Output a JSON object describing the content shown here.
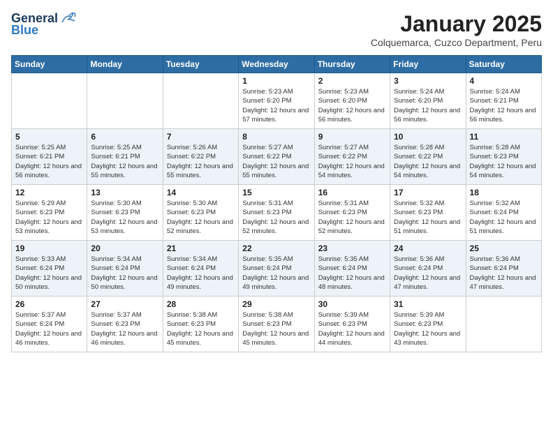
{
  "logo": {
    "general": "General",
    "blue": "Blue"
  },
  "title": "January 2025",
  "subtitle": "Colquemarca, Cuzco Department, Peru",
  "weekdays": [
    "Sunday",
    "Monday",
    "Tuesday",
    "Wednesday",
    "Thursday",
    "Friday",
    "Saturday"
  ],
  "weeks": [
    [
      {
        "day": "",
        "sunrise": "",
        "sunset": "",
        "daylight": ""
      },
      {
        "day": "",
        "sunrise": "",
        "sunset": "",
        "daylight": ""
      },
      {
        "day": "",
        "sunrise": "",
        "sunset": "",
        "daylight": ""
      },
      {
        "day": "1",
        "sunrise": "Sunrise: 5:23 AM",
        "sunset": "Sunset: 6:20 PM",
        "daylight": "Daylight: 12 hours and 57 minutes."
      },
      {
        "day": "2",
        "sunrise": "Sunrise: 5:23 AM",
        "sunset": "Sunset: 6:20 PM",
        "daylight": "Daylight: 12 hours and 56 minutes."
      },
      {
        "day": "3",
        "sunrise": "Sunrise: 5:24 AM",
        "sunset": "Sunset: 6:20 PM",
        "daylight": "Daylight: 12 hours and 56 minutes."
      },
      {
        "day": "4",
        "sunrise": "Sunrise: 5:24 AM",
        "sunset": "Sunset: 6:21 PM",
        "daylight": "Daylight: 12 hours and 56 minutes."
      }
    ],
    [
      {
        "day": "5",
        "sunrise": "Sunrise: 5:25 AM",
        "sunset": "Sunset: 6:21 PM",
        "daylight": "Daylight: 12 hours and 56 minutes."
      },
      {
        "day": "6",
        "sunrise": "Sunrise: 5:25 AM",
        "sunset": "Sunset: 6:21 PM",
        "daylight": "Daylight: 12 hours and 55 minutes."
      },
      {
        "day": "7",
        "sunrise": "Sunrise: 5:26 AM",
        "sunset": "Sunset: 6:22 PM",
        "daylight": "Daylight: 12 hours and 55 minutes."
      },
      {
        "day": "8",
        "sunrise": "Sunrise: 5:27 AM",
        "sunset": "Sunset: 6:22 PM",
        "daylight": "Daylight: 12 hours and 55 minutes."
      },
      {
        "day": "9",
        "sunrise": "Sunrise: 5:27 AM",
        "sunset": "Sunset: 6:22 PM",
        "daylight": "Daylight: 12 hours and 54 minutes."
      },
      {
        "day": "10",
        "sunrise": "Sunrise: 5:28 AM",
        "sunset": "Sunset: 6:22 PM",
        "daylight": "Daylight: 12 hours and 54 minutes."
      },
      {
        "day": "11",
        "sunrise": "Sunrise: 5:28 AM",
        "sunset": "Sunset: 6:23 PM",
        "daylight": "Daylight: 12 hours and 54 minutes."
      }
    ],
    [
      {
        "day": "12",
        "sunrise": "Sunrise: 5:29 AM",
        "sunset": "Sunset: 6:23 PM",
        "daylight": "Daylight: 12 hours and 53 minutes."
      },
      {
        "day": "13",
        "sunrise": "Sunrise: 5:30 AM",
        "sunset": "Sunset: 6:23 PM",
        "daylight": "Daylight: 12 hours and 53 minutes."
      },
      {
        "day": "14",
        "sunrise": "Sunrise: 5:30 AM",
        "sunset": "Sunset: 6:23 PM",
        "daylight": "Daylight: 12 hours and 52 minutes."
      },
      {
        "day": "15",
        "sunrise": "Sunrise: 5:31 AM",
        "sunset": "Sunset: 6:23 PM",
        "daylight": "Daylight: 12 hours and 52 minutes."
      },
      {
        "day": "16",
        "sunrise": "Sunrise: 5:31 AM",
        "sunset": "Sunset: 6:23 PM",
        "daylight": "Daylight: 12 hours and 52 minutes."
      },
      {
        "day": "17",
        "sunrise": "Sunrise: 5:32 AM",
        "sunset": "Sunset: 6:23 PM",
        "daylight": "Daylight: 12 hours and 51 minutes."
      },
      {
        "day": "18",
        "sunrise": "Sunrise: 5:32 AM",
        "sunset": "Sunset: 6:24 PM",
        "daylight": "Daylight: 12 hours and 51 minutes."
      }
    ],
    [
      {
        "day": "19",
        "sunrise": "Sunrise: 5:33 AM",
        "sunset": "Sunset: 6:24 PM",
        "daylight": "Daylight: 12 hours and 50 minutes."
      },
      {
        "day": "20",
        "sunrise": "Sunrise: 5:34 AM",
        "sunset": "Sunset: 6:24 PM",
        "daylight": "Daylight: 12 hours and 50 minutes."
      },
      {
        "day": "21",
        "sunrise": "Sunrise: 5:34 AM",
        "sunset": "Sunset: 6:24 PM",
        "daylight": "Daylight: 12 hours and 49 minutes."
      },
      {
        "day": "22",
        "sunrise": "Sunrise: 5:35 AM",
        "sunset": "Sunset: 6:24 PM",
        "daylight": "Daylight: 12 hours and 49 minutes."
      },
      {
        "day": "23",
        "sunrise": "Sunrise: 5:35 AM",
        "sunset": "Sunset: 6:24 PM",
        "daylight": "Daylight: 12 hours and 48 minutes."
      },
      {
        "day": "24",
        "sunrise": "Sunrise: 5:36 AM",
        "sunset": "Sunset: 6:24 PM",
        "daylight": "Daylight: 12 hours and 47 minutes."
      },
      {
        "day": "25",
        "sunrise": "Sunrise: 5:36 AM",
        "sunset": "Sunset: 6:24 PM",
        "daylight": "Daylight: 12 hours and 47 minutes."
      }
    ],
    [
      {
        "day": "26",
        "sunrise": "Sunrise: 5:37 AM",
        "sunset": "Sunset: 6:24 PM",
        "daylight": "Daylight: 12 hours and 46 minutes."
      },
      {
        "day": "27",
        "sunrise": "Sunrise: 5:37 AM",
        "sunset": "Sunset: 6:23 PM",
        "daylight": "Daylight: 12 hours and 46 minutes."
      },
      {
        "day": "28",
        "sunrise": "Sunrise: 5:38 AM",
        "sunset": "Sunset: 6:23 PM",
        "daylight": "Daylight: 12 hours and 45 minutes."
      },
      {
        "day": "29",
        "sunrise": "Sunrise: 5:38 AM",
        "sunset": "Sunset: 6:23 PM",
        "daylight": "Daylight: 12 hours and 45 minutes."
      },
      {
        "day": "30",
        "sunrise": "Sunrise: 5:39 AM",
        "sunset": "Sunset: 6:23 PM",
        "daylight": "Daylight: 12 hours and 44 minutes."
      },
      {
        "day": "31",
        "sunrise": "Sunrise: 5:39 AM",
        "sunset": "Sunset: 6:23 PM",
        "daylight": "Daylight: 12 hours and 43 minutes."
      },
      {
        "day": "",
        "sunrise": "",
        "sunset": "",
        "daylight": ""
      }
    ]
  ]
}
